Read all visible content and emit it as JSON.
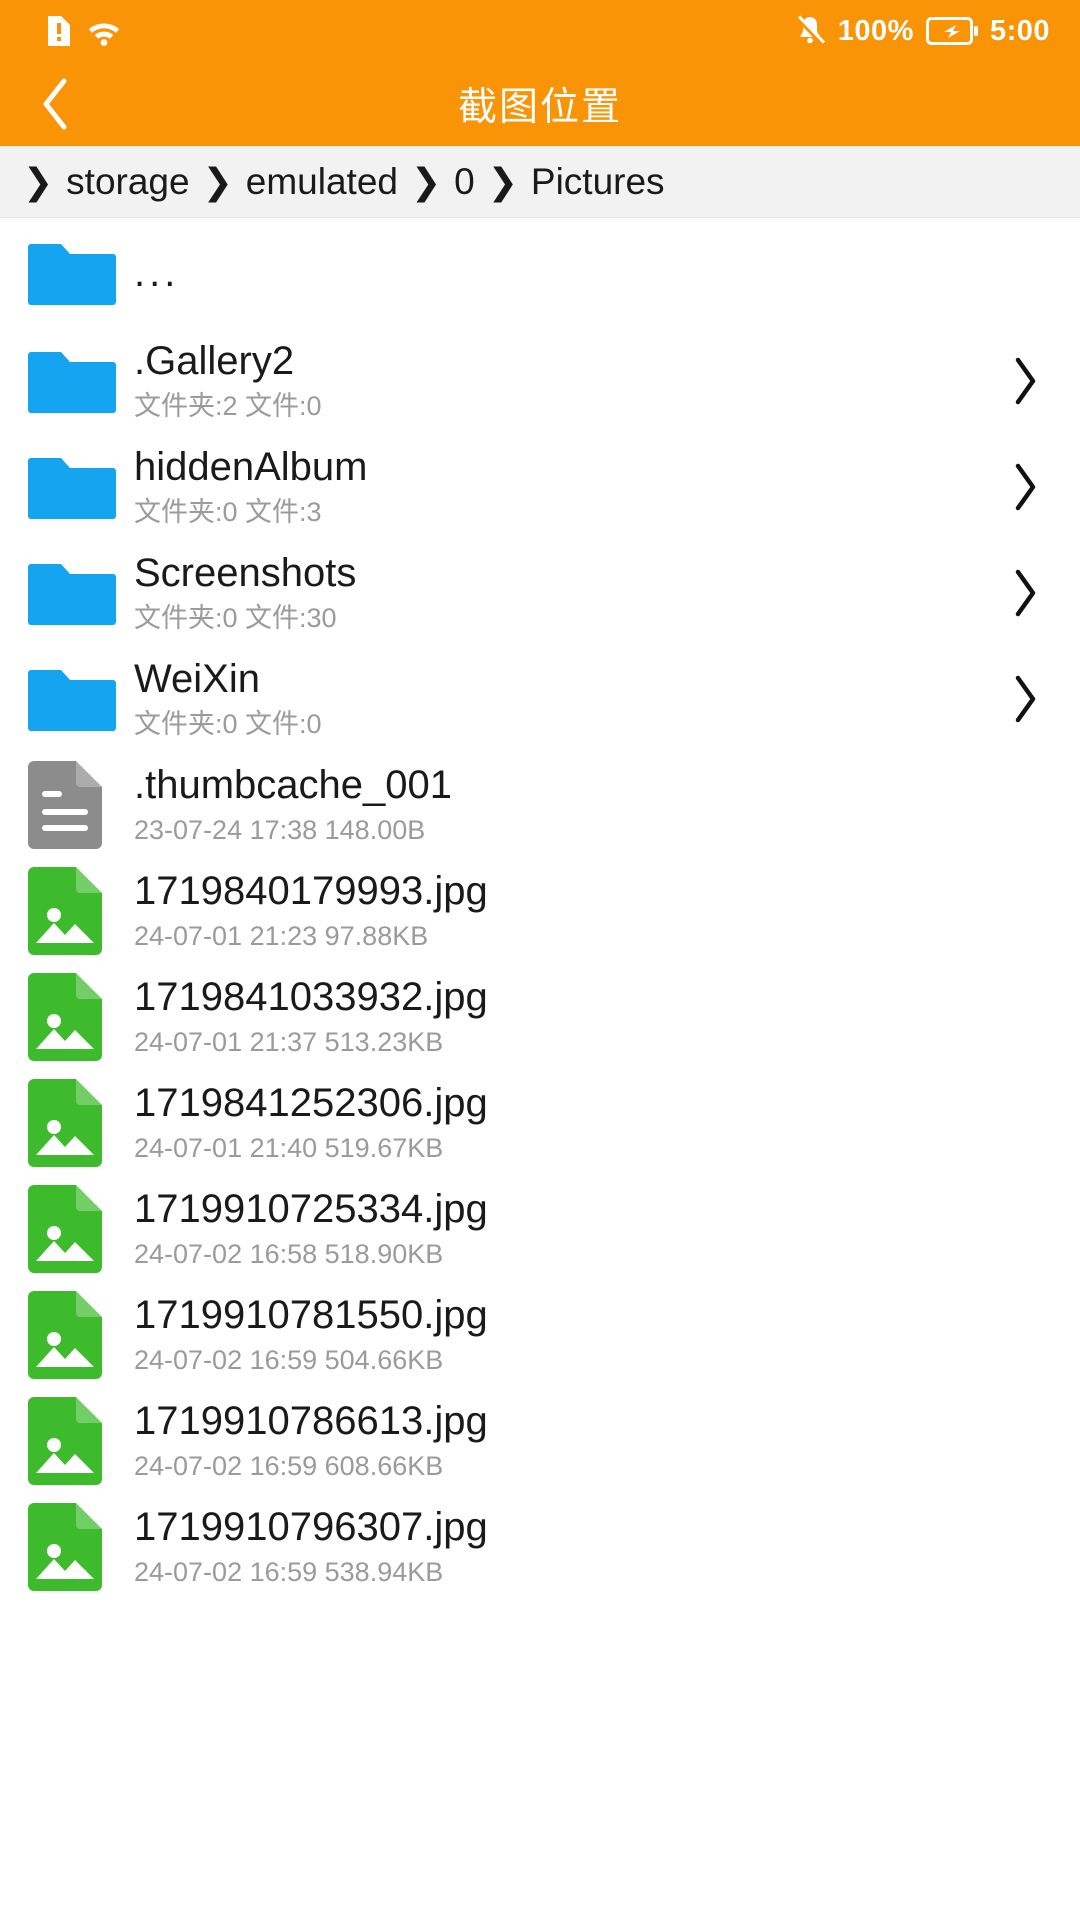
{
  "status_bar": {
    "icons_left": [
      "sim-card-alert-icon",
      "wifi-icon"
    ],
    "notification_icon": "bell-muted-icon",
    "battery_percent": "100%",
    "battery_icon": "battery-charging-icon",
    "time": "5:00",
    "background_color": "#F89406"
  },
  "title_bar": {
    "back_icon": "chevron-left-icon",
    "title": "截图位置"
  },
  "breadcrumb": {
    "separator": "❯",
    "segments": [
      "storage",
      "emulated",
      "0",
      "Pictures"
    ]
  },
  "list": {
    "chevron": "❯",
    "items": [
      {
        "name": "...",
        "sub": "",
        "icon": "folder-icon",
        "has_chevron": false,
        "type": "parent"
      },
      {
        "name": ".Gallery2",
        "sub": "文件夹:2 文件:0",
        "icon": "folder-icon",
        "has_chevron": true,
        "type": "folder"
      },
      {
        "name": "hiddenAlbum",
        "sub": "文件夹:0 文件:3",
        "icon": "folder-icon",
        "has_chevron": true,
        "type": "folder"
      },
      {
        "name": "Screenshots",
        "sub": "文件夹:0 文件:30",
        "icon": "folder-icon",
        "has_chevron": true,
        "type": "folder"
      },
      {
        "name": "WeiXin",
        "sub": "文件夹:0 文件:0",
        "icon": "folder-icon",
        "has_chevron": true,
        "type": "folder"
      },
      {
        "name": ".thumbcache_001",
        "sub": "23-07-24 17:38  148.00B",
        "icon": "file-doc-icon",
        "has_chevron": false,
        "type": "file"
      },
      {
        "name": "1719840179993.jpg",
        "sub": "24-07-01 21:23  97.88KB",
        "icon": "file-image-icon",
        "has_chevron": false,
        "type": "image"
      },
      {
        "name": "1719841033932.jpg",
        "sub": "24-07-01 21:37  513.23KB",
        "icon": "file-image-icon",
        "has_chevron": false,
        "type": "image"
      },
      {
        "name": "1719841252306.jpg",
        "sub": "24-07-01 21:40  519.67KB",
        "icon": "file-image-icon",
        "has_chevron": false,
        "type": "image"
      },
      {
        "name": "1719910725334.jpg",
        "sub": "24-07-02 16:58  518.90KB",
        "icon": "file-image-icon",
        "has_chevron": false,
        "type": "image"
      },
      {
        "name": "1719910781550.jpg",
        "sub": "24-07-02 16:59  504.66KB",
        "icon": "file-image-icon",
        "has_chevron": false,
        "type": "image"
      },
      {
        "name": "1719910786613.jpg",
        "sub": "24-07-02 16:59  608.66KB",
        "icon": "file-image-icon",
        "has_chevron": false,
        "type": "image"
      },
      {
        "name": "1719910796307.jpg",
        "sub": "24-07-02 16:59  538.94KB",
        "icon": "file-image-icon",
        "has_chevron": false,
        "type": "image"
      }
    ]
  },
  "colors": {
    "accent_orange": "#F89406",
    "folder_blue": "#14A4F0",
    "image_green": "#3DBB2D",
    "doc_gray": "#8C8C8C",
    "breadcrumb_bg": "#F2F2F2",
    "name_text": "#1a1a1a",
    "sub_text": "#9b9b9b"
  }
}
